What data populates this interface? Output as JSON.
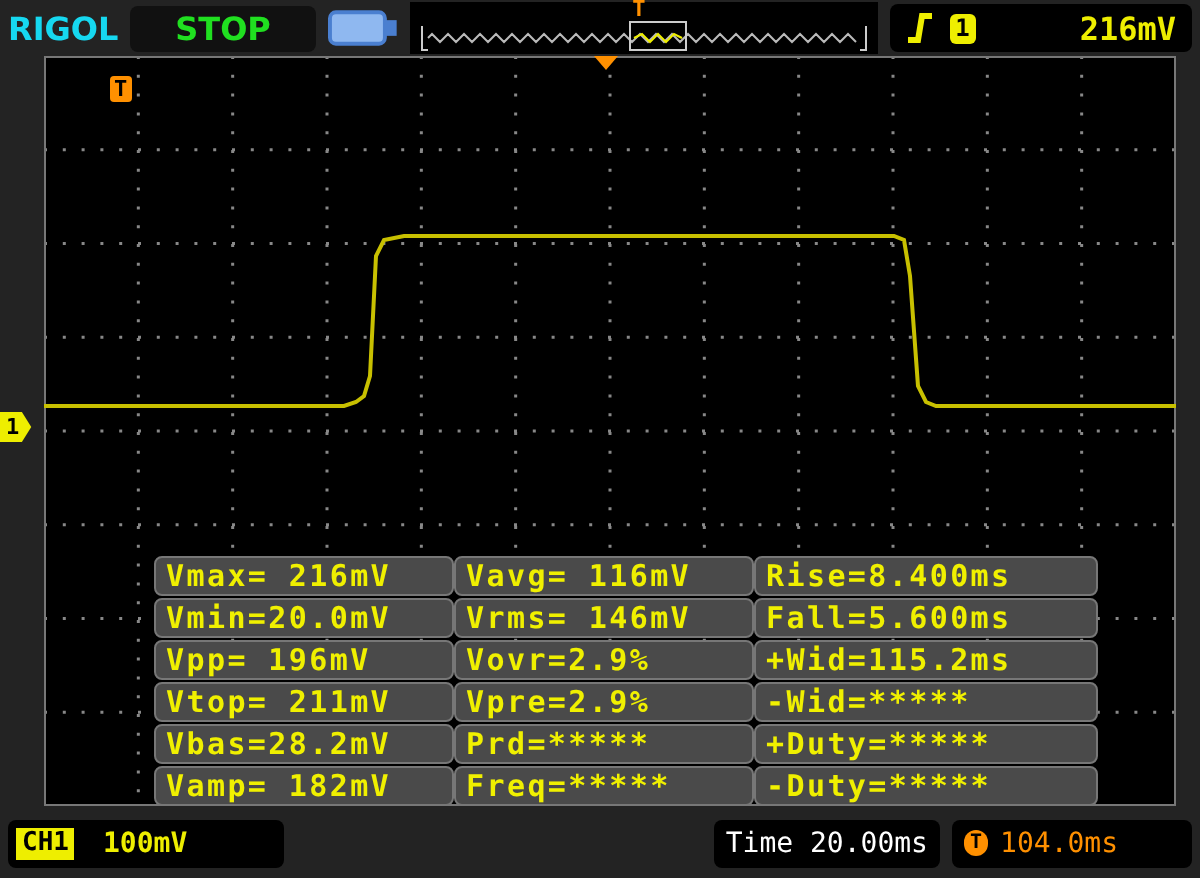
{
  "top_bar": {
    "brand": "RIGOL",
    "run_state": "STOP",
    "overview_marker": "T",
    "trigger_channel": "1",
    "trigger_level": "216mV"
  },
  "plot": {
    "trigger_marker": "T",
    "channel_marker": "1"
  },
  "measurements": [
    {
      "cells": [
        "Vmax= 216mV",
        "Vavg= 116mV",
        "Rise=8.400ms"
      ]
    },
    {
      "cells": [
        "Vmin=20.0mV",
        "Vrms= 146mV",
        "Fall=5.600ms"
      ]
    },
    {
      "cells": [
        "Vpp= 196mV",
        "Vovr=2.9%",
        "+Wid=115.2ms"
      ]
    },
    {
      "cells": [
        "Vtop= 211mV",
        "Vpre=2.9%",
        "-Wid=*****"
      ]
    },
    {
      "cells": [
        "Vbas=28.2mV",
        "Prd=*****",
        "+Duty=*****"
      ]
    },
    {
      "cells": [
        "Vamp= 182mV",
        "Freq=*****",
        "-Duty=*****"
      ]
    }
  ],
  "bottom_bar": {
    "channel": "CH1",
    "scale": "100mV",
    "timebase": "Time 20.00ms",
    "offset_label": "T",
    "trigger_offset": "104.0ms"
  }
}
